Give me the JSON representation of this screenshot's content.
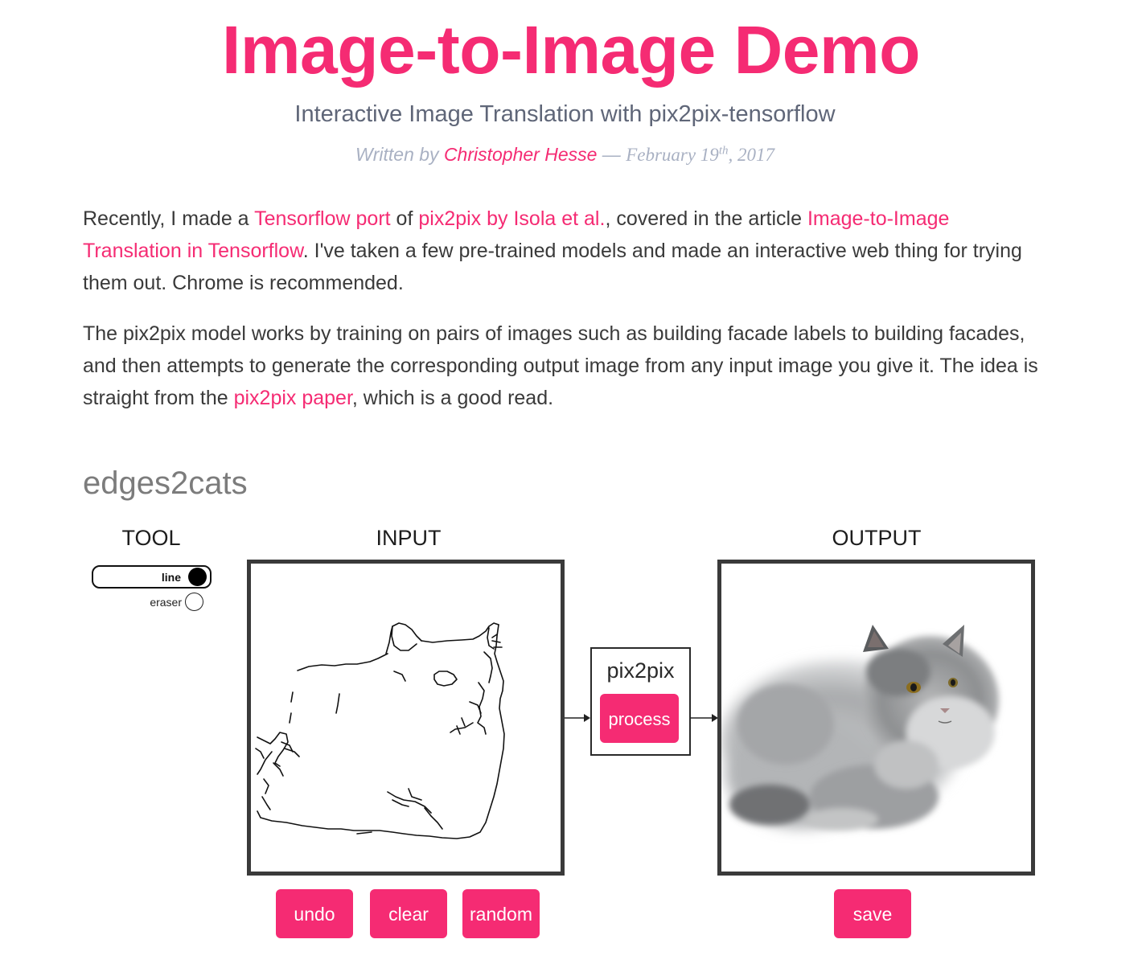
{
  "page": {
    "title": "Image-to-Image Demo",
    "subtitle": "Interactive Image Translation with pix2pix-tensorflow",
    "byline": {
      "prefix": "Written by",
      "author": "Christopher Hesse",
      "separator": "—",
      "date_main": "February 19",
      "date_suffix": "th",
      "date_year": ", 2017"
    }
  },
  "intro": {
    "p1": {
      "t1": "Recently, I made a ",
      "link1": "Tensorflow port",
      "t2": " of ",
      "link2": "pix2pix by Isola et al.",
      "t3": ", covered in the article ",
      "link3": "Image-to-Image Translation in Tensorflow",
      "t4": ". I've taken a few pre-trained models and made an interactive web thing for trying them out. Chrome is recommended."
    },
    "p2": {
      "t1": "The pix2pix model works by training on pairs of images such as building facade labels to building facades, and then attempts to generate the corresponding output image from any input image you give it. The idea is straight from the ",
      "link1": "pix2pix paper",
      "t2": ", which is a good read."
    }
  },
  "demo": {
    "heading": "edges2cats",
    "tool_label": "TOOL",
    "input_label": "INPUT",
    "output_label": "OUTPUT",
    "tools": {
      "line": "line",
      "eraser": "eraser",
      "selected": "line"
    },
    "model_label": "pix2pix",
    "buttons": {
      "process": "process",
      "undo": "undo",
      "clear": "clear",
      "random": "random",
      "save": "save"
    }
  },
  "colors": {
    "accent": "#f52b73",
    "text": "#3a3a3a",
    "subtitle": "#5f6678",
    "byline": "#a9b1c3",
    "heading": "#7c7c7c",
    "frame": "#3a3a3a"
  }
}
